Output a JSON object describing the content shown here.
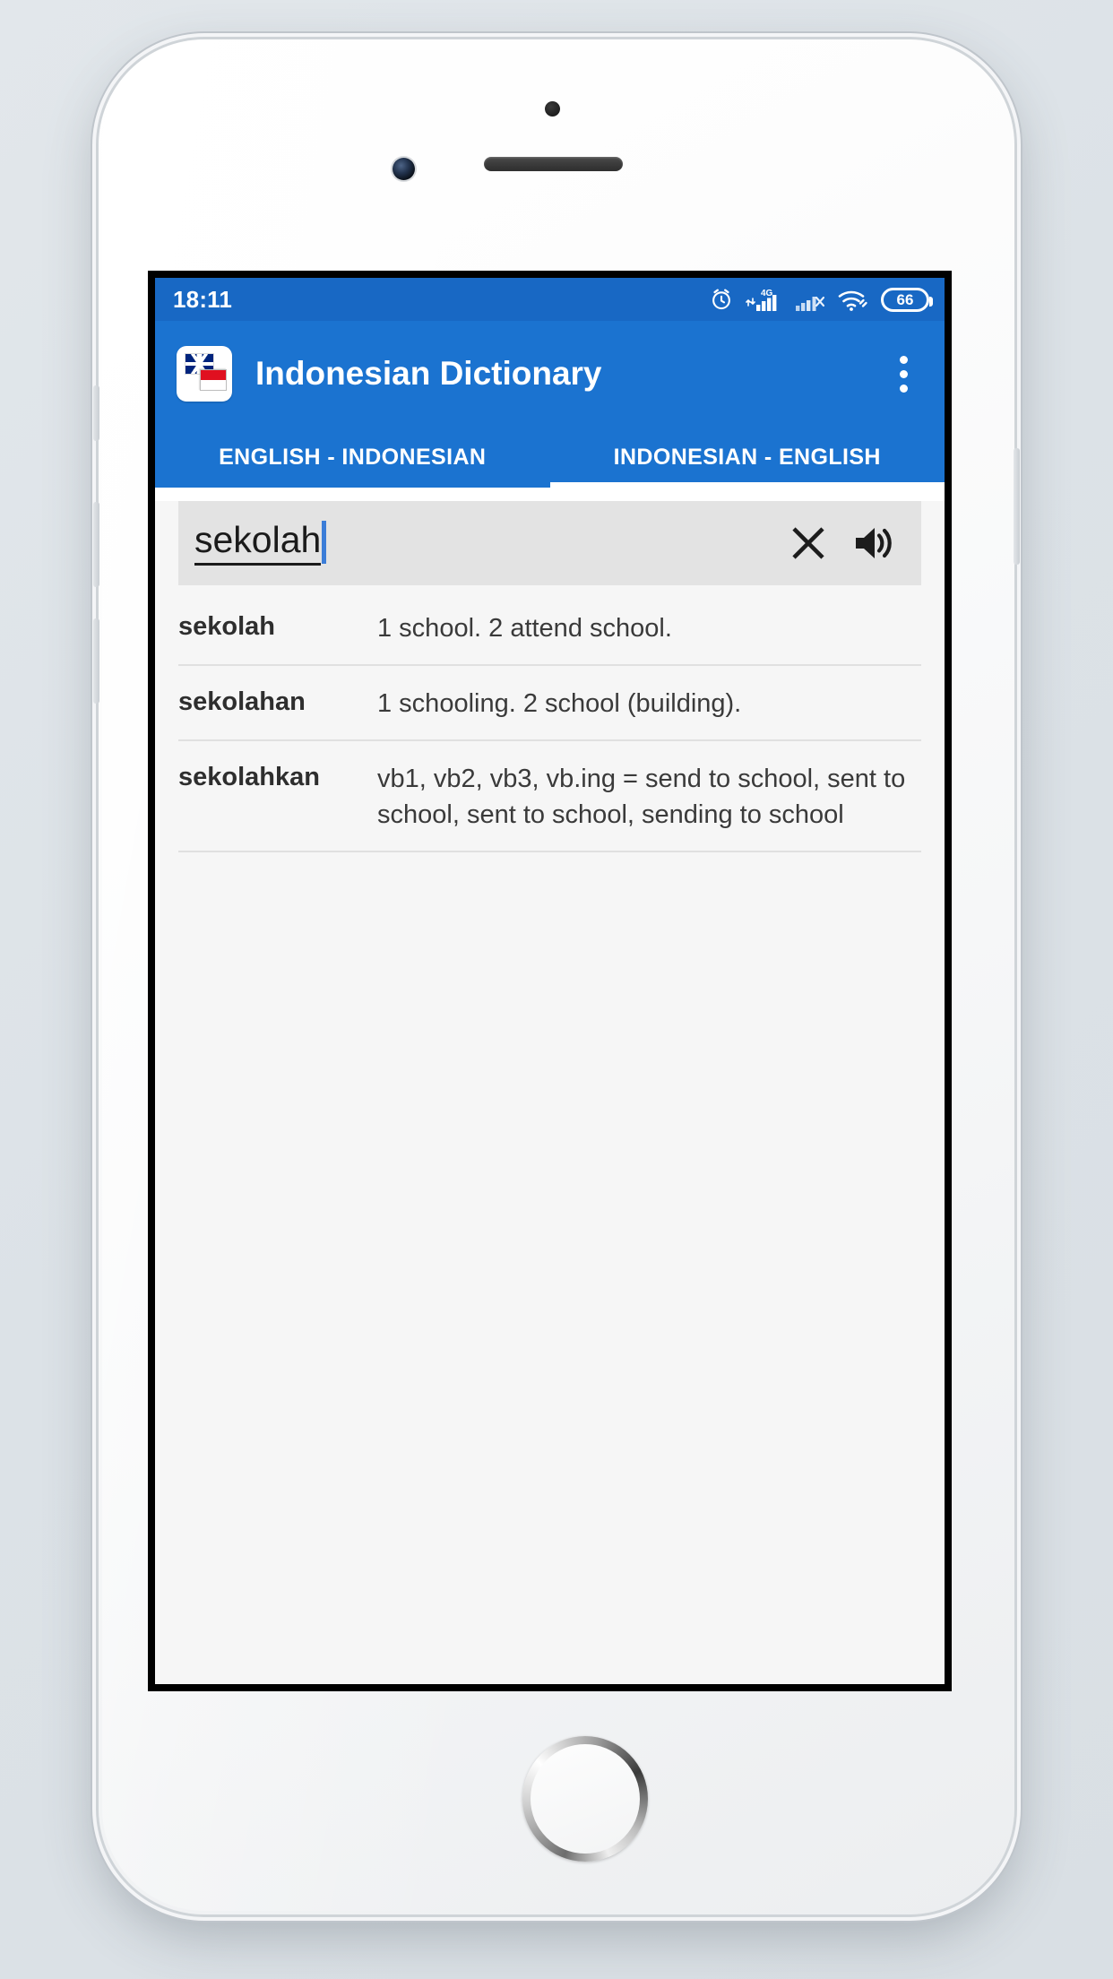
{
  "status_bar": {
    "time": "18:11",
    "battery_level": "66",
    "icons": [
      "alarm-clock-icon",
      "signal-4g-icon",
      "signal-secondary-icon",
      "wifi-icon",
      "battery-icon"
    ],
    "network_label": "4G",
    "background_color": "#1868c4"
  },
  "app_bar": {
    "title": "Indonesian Dictionary",
    "app_icon": "uk-indonesia-flags-icon",
    "overflow_menu": "overflow-menu-icon",
    "background_color": "#1b73d0"
  },
  "tabs": [
    {
      "label": "ENGLISH - INDONESIAN",
      "active": false
    },
    {
      "label": "INDONESIAN - ENGLISH",
      "active": true
    }
  ],
  "search": {
    "value": "sekolah",
    "placeholder": "",
    "clear_icon": "close-icon",
    "speak_icon": "speaker-icon",
    "background_color": "#e3e3e3",
    "caret_color": "#3b7dd8"
  },
  "results": [
    {
      "term": "sekolah",
      "definition": "1 school. 2 attend school."
    },
    {
      "term": "sekolahan",
      "definition": "1 schooling. 2 school (building)."
    },
    {
      "term": "sekolahkan",
      "definition": "vb1, vb2, vb3, vb.ing = send to school, sent to school, sent to school, sending to school"
    }
  ]
}
